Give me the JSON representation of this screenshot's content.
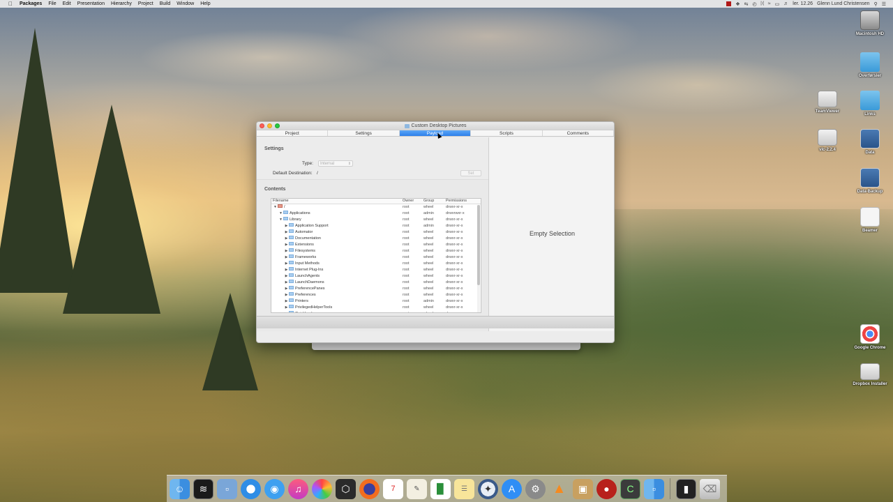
{
  "menubar": {
    "app_name": "Packages",
    "items": [
      "File",
      "Edit",
      "Presentation",
      "Hierarchy",
      "Project",
      "Build",
      "Window",
      "Help"
    ],
    "clock": "ler. 12.26",
    "user": "Glenn Lund Christensen"
  },
  "desktop_icons": [
    {
      "label": "Macintosh HD",
      "icon": "hard-drive-icon"
    },
    {
      "label": "Overførsler",
      "icon": "folder-icon"
    },
    {
      "label": "TeamViewer",
      "icon": "drive-icon"
    },
    {
      "label": "Links",
      "icon": "folder-icon"
    },
    {
      "label": "vlc-2.2.4",
      "icon": "drive-icon"
    },
    {
      "label": "Data",
      "icon": "server-icon"
    },
    {
      "label": "Data-Backup",
      "icon": "server-icon"
    },
    {
      "label": "Beamer",
      "icon": "beamer-icon"
    },
    {
      "label": "Google Chrome",
      "icon": "chrome-icon"
    },
    {
      "label": "Dropbox Installer",
      "icon": "drive-icon"
    }
  ],
  "window": {
    "title": "Custom Desktop Pictures",
    "tabs": [
      "Project",
      "Settings",
      "Payload",
      "Scripts",
      "Comments"
    ],
    "active_tab": "Payload",
    "settings": {
      "heading": "Settings",
      "type_label": "Type:",
      "type_value": "Internal",
      "dest_label": "Default Destination:",
      "dest_value": "/",
      "set_button": "Set"
    },
    "contents": {
      "heading": "Contents",
      "columns": [
        "Filename",
        "Owner",
        "Group",
        "Permissions"
      ],
      "rows": [
        {
          "name": "/",
          "owner": "root",
          "group": "wheel",
          "perm": "drwxr-xr-x"
        },
        {
          "name": "Applications",
          "owner": "root",
          "group": "admin",
          "perm": "drwxrwxr-x"
        },
        {
          "name": "Library",
          "owner": "root",
          "group": "wheel",
          "perm": "drwxr-xr-x"
        },
        {
          "name": "Application Support",
          "owner": "root",
          "group": "admin",
          "perm": "drwxr-xr-x"
        },
        {
          "name": "Automator",
          "owner": "root",
          "group": "wheel",
          "perm": "drwxr-xr-x"
        },
        {
          "name": "Documentation",
          "owner": "root",
          "group": "wheel",
          "perm": "drwxr-xr-x"
        },
        {
          "name": "Extensions",
          "owner": "root",
          "group": "wheel",
          "perm": "drwxr-xr-x"
        },
        {
          "name": "Filesystems",
          "owner": "root",
          "group": "wheel",
          "perm": "drwxr-xr-x"
        },
        {
          "name": "Frameworks",
          "owner": "root",
          "group": "wheel",
          "perm": "drwxr-xr-x"
        },
        {
          "name": "Input Methods",
          "owner": "root",
          "group": "wheel",
          "perm": "drwxr-xr-x"
        },
        {
          "name": "Internet Plug-Ins",
          "owner": "root",
          "group": "wheel",
          "perm": "drwxr-xr-x"
        },
        {
          "name": "LaunchAgents",
          "owner": "root",
          "group": "wheel",
          "perm": "drwxr-xr-x"
        },
        {
          "name": "LaunchDaemons",
          "owner": "root",
          "group": "wheel",
          "perm": "drwxr-xr-x"
        },
        {
          "name": "PreferencePanes",
          "owner": "root",
          "group": "wheel",
          "perm": "drwxr-xr-x"
        },
        {
          "name": "Preferences",
          "owner": "root",
          "group": "wheel",
          "perm": "drwxr-xr-x"
        },
        {
          "name": "Printers",
          "owner": "root",
          "group": "admin",
          "perm": "drwxr-xr-x"
        },
        {
          "name": "PrivilegedHelperTools",
          "owner": "root",
          "group": "wheel",
          "perm": "drwxr-xr-x"
        },
        {
          "name": "QuickLook",
          "owner": "root",
          "group": "wheel",
          "perm": "drwxr-xr-x"
        }
      ]
    },
    "empty_selection": "Empty Selection"
  },
  "dock": [
    "Finder",
    "Activity Monitor",
    "Preview",
    "Safari",
    "Messages",
    "iTunes",
    "Photos",
    "Unity",
    "Firefox",
    "Calendar",
    "TextEdit",
    "Numbers",
    "Notes",
    "Directory Utility",
    "App Store",
    "System Preferences",
    "VLC",
    "Packages",
    "Boxing",
    "Console",
    "Finder 2",
    "Terminal",
    "Trash"
  ],
  "colors": {
    "accent": "#2d80eb"
  }
}
